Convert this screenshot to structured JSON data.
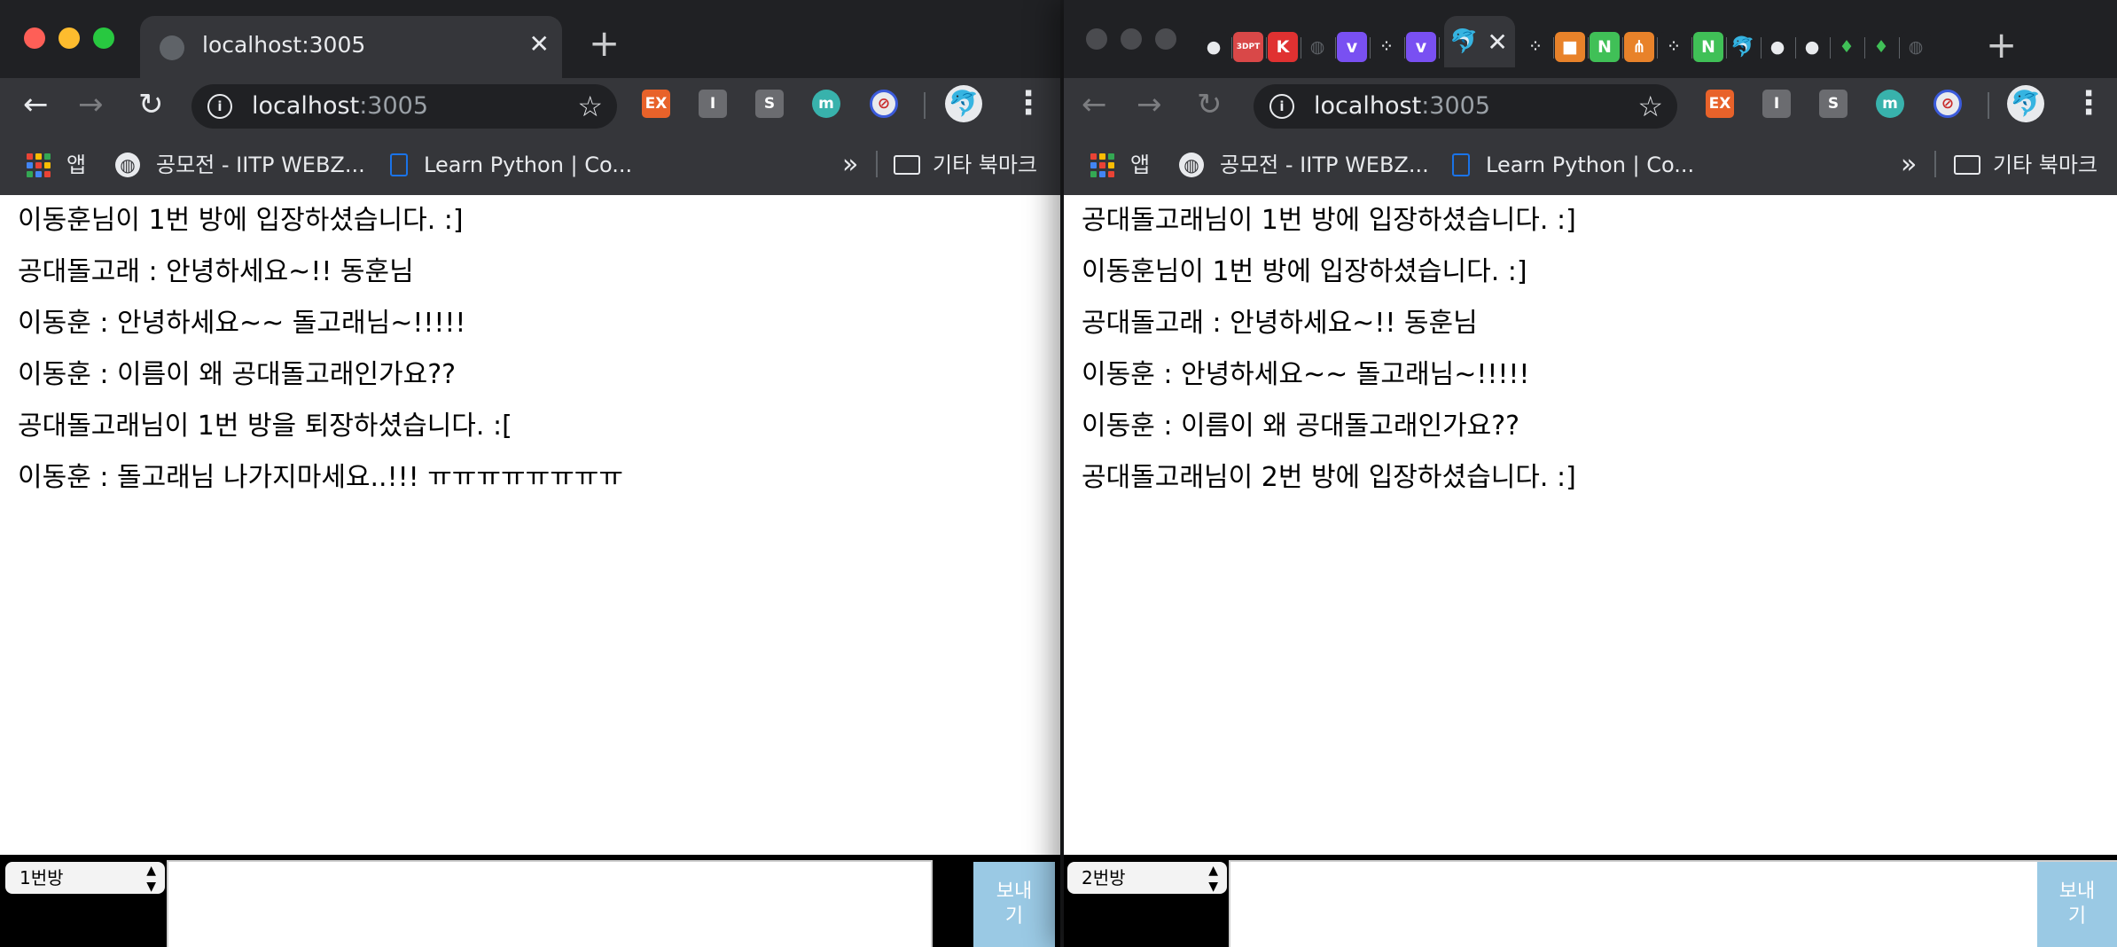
{
  "left": {
    "tab": {
      "title": "localhost:3005",
      "close": "✕"
    },
    "newtab": "+",
    "url": {
      "host": "localhost",
      "port": ":3005"
    },
    "extensions": [
      "EX",
      "I",
      "S",
      "m"
    ],
    "bookmarks": {
      "apps": "앱",
      "item1": "공모전 - IITP WEBZ...",
      "item2": "Learn Python | Co...",
      "more": "»",
      "other": "기타 북마크"
    },
    "messages": [
      "이동훈님이 1번 방에 입장하셨습니다. :]",
      "공대돌고래 : 안녕하세요~!! 동훈님",
      "이동훈 : 안녕하세요~~ 돌고래님~!!!!!",
      "이동훈 : 이름이 왜 공대돌고래인가요??",
      "공대돌고래님이 1번 방을 퇴장하셨습니다. :[",
      "이동훈 : 돌고래님 나가지마세요..!!! ㅠㅠㅠㅠㅠㅠㅠㅠ"
    ],
    "form": {
      "room": "1번방",
      "send": "보내기",
      "message_value": ""
    }
  },
  "right": {
    "newtab": "+",
    "url": {
      "host": "localhost",
      "port": ":3005"
    },
    "mini_tabs": [
      "3DPT",
      "K",
      "v",
      "v",
      "N",
      "N"
    ],
    "extensions": [
      "EX",
      "I",
      "S",
      "m"
    ],
    "bookmarks": {
      "apps": "앱",
      "item1": "공모전 - IITP WEBZ...",
      "item2": "Learn Python | Co...",
      "more": "»",
      "other": "기타 북마크"
    },
    "messages": [
      "공대돌고래님이 1번 방에 입장하셨습니다. :]",
      "이동훈님이 1번 방에 입장하셨습니다. :]",
      "공대돌고래 : 안녕하세요~!! 동훈님",
      "이동훈 : 안녕하세요~~ 돌고래님~!!!!!",
      "이동훈 : 이름이 왜 공대돌고래인가요??",
      "공대돌고래님이 2번 방에 입장하셨습니다. :]"
    ],
    "form": {
      "room": "2번방",
      "send": "보내기",
      "message_value": ""
    }
  },
  "colors": {
    "tabstrip": "#202124",
    "toolbar": "#35363a",
    "send_button": "#9ac9e4",
    "traffic_red": "#fe5f57",
    "traffic_yellow": "#febc2e",
    "traffic_green": "#28c840"
  },
  "icons": {
    "back": "←",
    "forward": "→",
    "reload": "↻",
    "star": "☆",
    "kebab": "⋮",
    "profile": "dolphin-avatar"
  }
}
